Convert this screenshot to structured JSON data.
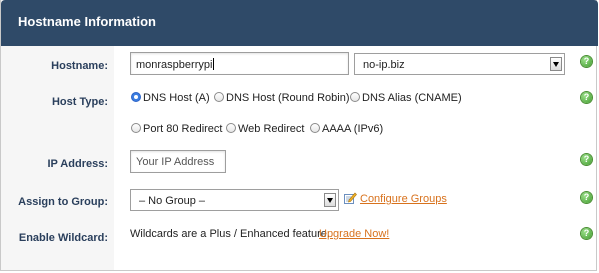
{
  "header": {
    "title": "Hostname Information"
  },
  "labels": {
    "hostname": "Hostname:",
    "host_type": "Host Type:",
    "ip_address": "IP Address:",
    "assign_group": "Assign to Group:",
    "enable_wildcard": "Enable Wildcard:"
  },
  "hostname": {
    "value": "monraspberrypi",
    "domain_selected": "no-ip.biz"
  },
  "host_type": {
    "options": [
      {
        "label": "DNS Host (A)",
        "checked": true
      },
      {
        "label": "DNS Host (Round Robin)",
        "checked": false
      },
      {
        "label": "DNS Alias (CNAME)",
        "checked": false
      },
      {
        "label": "Port 80 Redirect",
        "checked": false
      },
      {
        "label": "Web Redirect",
        "checked": false
      },
      {
        "label": "AAAA (IPv6)",
        "checked": false
      }
    ]
  },
  "ip_address": {
    "placeholder": "Your IP Address"
  },
  "group": {
    "selected": "– No Group –",
    "configure_link": "Configure Groups"
  },
  "wildcard": {
    "text": "Wildcards are a Plus / Enhanced feature.",
    "link": "Upgrade Now!"
  },
  "help_glyph": "?",
  "colors": {
    "header_bg": "#2f4a68",
    "label": "#2a3f5c",
    "link": "#d8721d",
    "help": "#3f9a2c"
  }
}
